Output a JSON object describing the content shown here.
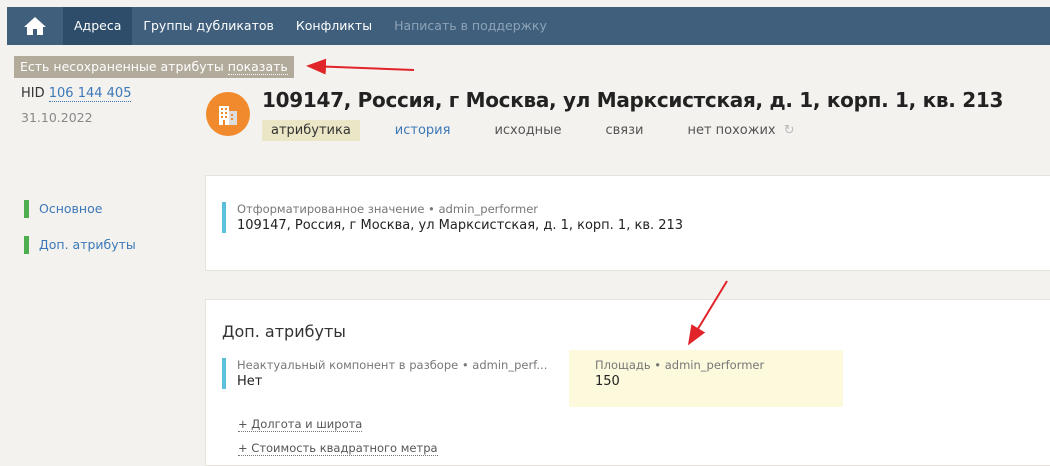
{
  "nav": {
    "items": [
      {
        "label": "Адреса",
        "active": true
      },
      {
        "label": "Группы дубликатов"
      },
      {
        "label": "Конфликты"
      },
      {
        "label": "Написать в поддержку",
        "muted": true
      }
    ]
  },
  "banner": {
    "text": "Есть несохраненные атрибуты",
    "link": "показать"
  },
  "record": {
    "hid_label": "HID",
    "hid_value": "106 144 405",
    "date": "31.10.2022",
    "title": "109147, Россия, г Москва, ул Марксистская, д. 1, корп. 1, кв. 213"
  },
  "tabs": [
    {
      "label": "атрибутика",
      "active": true
    },
    {
      "label": "история",
      "link": true
    },
    {
      "label": "исходные"
    },
    {
      "label": "связи"
    },
    {
      "label": "нет похожих"
    }
  ],
  "sidebar": {
    "items": [
      {
        "label": "Основное"
      },
      {
        "label": "Доп. атрибуты"
      }
    ]
  },
  "main_card": {
    "field_label": "Отформатированное значение • admin_performer",
    "field_value": "109147, Россия, г Москва, ул Марксистская, д. 1, корп. 1, кв. 213"
  },
  "extra_card": {
    "title": "Доп. атрибуты",
    "fields": [
      {
        "label": "Неактуальный компонент в разборе • admin_perf...",
        "value": "Нет"
      },
      {
        "label": "Площадь • admin_performer",
        "value": "150"
      }
    ],
    "add_links": [
      "+ Долгота и широта",
      "+ Стоимость квадратного метра"
    ]
  },
  "colors": {
    "nav_bg": "#3f5f7c",
    "banner_bg": "#b2aa9a",
    "accent_link": "#3c78b8",
    "field_bar": "#5bc0de",
    "side_bar": "#4cae4c",
    "highlight": "#fcf9dc",
    "arrow": "#e0242a"
  },
  "icons": {
    "home": "home-icon",
    "building": "building-icon",
    "refresh": "refresh-icon"
  }
}
